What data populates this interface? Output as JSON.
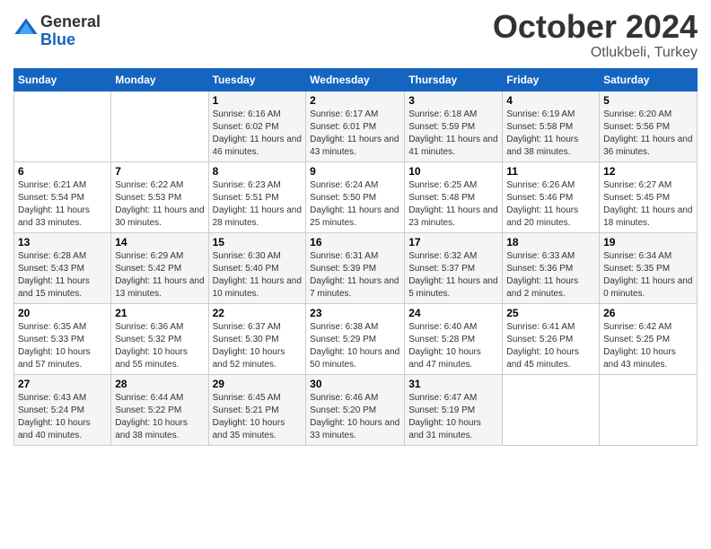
{
  "logo": {
    "general": "General",
    "blue": "Blue"
  },
  "header": {
    "month_year": "October 2024",
    "location": "Otlukbeli, Turkey"
  },
  "weekdays": [
    "Sunday",
    "Monday",
    "Tuesday",
    "Wednesday",
    "Thursday",
    "Friday",
    "Saturday"
  ],
  "weeks": [
    [
      {
        "day": "",
        "sunrise": "",
        "sunset": "",
        "daylight": ""
      },
      {
        "day": "",
        "sunrise": "",
        "sunset": "",
        "daylight": ""
      },
      {
        "day": "1",
        "sunrise": "Sunrise: 6:16 AM",
        "sunset": "Sunset: 6:02 PM",
        "daylight": "Daylight: 11 hours and 46 minutes."
      },
      {
        "day": "2",
        "sunrise": "Sunrise: 6:17 AM",
        "sunset": "Sunset: 6:01 PM",
        "daylight": "Daylight: 11 hours and 43 minutes."
      },
      {
        "day": "3",
        "sunrise": "Sunrise: 6:18 AM",
        "sunset": "Sunset: 5:59 PM",
        "daylight": "Daylight: 11 hours and 41 minutes."
      },
      {
        "day": "4",
        "sunrise": "Sunrise: 6:19 AM",
        "sunset": "Sunset: 5:58 PM",
        "daylight": "Daylight: 11 hours and 38 minutes."
      },
      {
        "day": "5",
        "sunrise": "Sunrise: 6:20 AM",
        "sunset": "Sunset: 5:56 PM",
        "daylight": "Daylight: 11 hours and 36 minutes."
      }
    ],
    [
      {
        "day": "6",
        "sunrise": "Sunrise: 6:21 AM",
        "sunset": "Sunset: 5:54 PM",
        "daylight": "Daylight: 11 hours and 33 minutes."
      },
      {
        "day": "7",
        "sunrise": "Sunrise: 6:22 AM",
        "sunset": "Sunset: 5:53 PM",
        "daylight": "Daylight: 11 hours and 30 minutes."
      },
      {
        "day": "8",
        "sunrise": "Sunrise: 6:23 AM",
        "sunset": "Sunset: 5:51 PM",
        "daylight": "Daylight: 11 hours and 28 minutes."
      },
      {
        "day": "9",
        "sunrise": "Sunrise: 6:24 AM",
        "sunset": "Sunset: 5:50 PM",
        "daylight": "Daylight: 11 hours and 25 minutes."
      },
      {
        "day": "10",
        "sunrise": "Sunrise: 6:25 AM",
        "sunset": "Sunset: 5:48 PM",
        "daylight": "Daylight: 11 hours and 23 minutes."
      },
      {
        "day": "11",
        "sunrise": "Sunrise: 6:26 AM",
        "sunset": "Sunset: 5:46 PM",
        "daylight": "Daylight: 11 hours and 20 minutes."
      },
      {
        "day": "12",
        "sunrise": "Sunrise: 6:27 AM",
        "sunset": "Sunset: 5:45 PM",
        "daylight": "Daylight: 11 hours and 18 minutes."
      }
    ],
    [
      {
        "day": "13",
        "sunrise": "Sunrise: 6:28 AM",
        "sunset": "Sunset: 5:43 PM",
        "daylight": "Daylight: 11 hours and 15 minutes."
      },
      {
        "day": "14",
        "sunrise": "Sunrise: 6:29 AM",
        "sunset": "Sunset: 5:42 PM",
        "daylight": "Daylight: 11 hours and 13 minutes."
      },
      {
        "day": "15",
        "sunrise": "Sunrise: 6:30 AM",
        "sunset": "Sunset: 5:40 PM",
        "daylight": "Daylight: 11 hours and 10 minutes."
      },
      {
        "day": "16",
        "sunrise": "Sunrise: 6:31 AM",
        "sunset": "Sunset: 5:39 PM",
        "daylight": "Daylight: 11 hours and 7 minutes."
      },
      {
        "day": "17",
        "sunrise": "Sunrise: 6:32 AM",
        "sunset": "Sunset: 5:37 PM",
        "daylight": "Daylight: 11 hours and 5 minutes."
      },
      {
        "day": "18",
        "sunrise": "Sunrise: 6:33 AM",
        "sunset": "Sunset: 5:36 PM",
        "daylight": "Daylight: 11 hours and 2 minutes."
      },
      {
        "day": "19",
        "sunrise": "Sunrise: 6:34 AM",
        "sunset": "Sunset: 5:35 PM",
        "daylight": "Daylight: 11 hours and 0 minutes."
      }
    ],
    [
      {
        "day": "20",
        "sunrise": "Sunrise: 6:35 AM",
        "sunset": "Sunset: 5:33 PM",
        "daylight": "Daylight: 10 hours and 57 minutes."
      },
      {
        "day": "21",
        "sunrise": "Sunrise: 6:36 AM",
        "sunset": "Sunset: 5:32 PM",
        "daylight": "Daylight: 10 hours and 55 minutes."
      },
      {
        "day": "22",
        "sunrise": "Sunrise: 6:37 AM",
        "sunset": "Sunset: 5:30 PM",
        "daylight": "Daylight: 10 hours and 52 minutes."
      },
      {
        "day": "23",
        "sunrise": "Sunrise: 6:38 AM",
        "sunset": "Sunset: 5:29 PM",
        "daylight": "Daylight: 10 hours and 50 minutes."
      },
      {
        "day": "24",
        "sunrise": "Sunrise: 6:40 AM",
        "sunset": "Sunset: 5:28 PM",
        "daylight": "Daylight: 10 hours and 47 minutes."
      },
      {
        "day": "25",
        "sunrise": "Sunrise: 6:41 AM",
        "sunset": "Sunset: 5:26 PM",
        "daylight": "Daylight: 10 hours and 45 minutes."
      },
      {
        "day": "26",
        "sunrise": "Sunrise: 6:42 AM",
        "sunset": "Sunset: 5:25 PM",
        "daylight": "Daylight: 10 hours and 43 minutes."
      }
    ],
    [
      {
        "day": "27",
        "sunrise": "Sunrise: 6:43 AM",
        "sunset": "Sunset: 5:24 PM",
        "daylight": "Daylight: 10 hours and 40 minutes."
      },
      {
        "day": "28",
        "sunrise": "Sunrise: 6:44 AM",
        "sunset": "Sunset: 5:22 PM",
        "daylight": "Daylight: 10 hours and 38 minutes."
      },
      {
        "day": "29",
        "sunrise": "Sunrise: 6:45 AM",
        "sunset": "Sunset: 5:21 PM",
        "daylight": "Daylight: 10 hours and 35 minutes."
      },
      {
        "day": "30",
        "sunrise": "Sunrise: 6:46 AM",
        "sunset": "Sunset: 5:20 PM",
        "daylight": "Daylight: 10 hours and 33 minutes."
      },
      {
        "day": "31",
        "sunrise": "Sunrise: 6:47 AM",
        "sunset": "Sunset: 5:19 PM",
        "daylight": "Daylight: 10 hours and 31 minutes."
      },
      {
        "day": "",
        "sunrise": "",
        "sunset": "",
        "daylight": ""
      },
      {
        "day": "",
        "sunrise": "",
        "sunset": "",
        "daylight": ""
      }
    ]
  ]
}
